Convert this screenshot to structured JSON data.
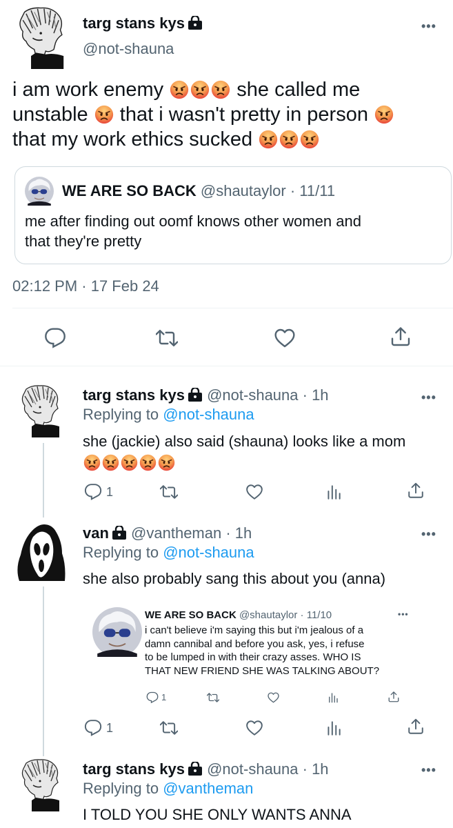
{
  "main_tweet": {
    "display_name": "targ stans kys",
    "handle": "@not-shauna",
    "text_line1_a": "i am work enemy",
    "text_line1_b": "she called me",
    "text_line2_a": "unstable",
    "text_line2_b": "that i wasn't pretty in person",
    "text_line3_a": "that my work ethics sucked",
    "timestamp": "02:12 PM · 17 Feb 24",
    "quote": {
      "display_name": "WE ARE SO BACK",
      "handle_date": "@shautaylor · 11/11",
      "text_line1": "me after finding out oomf knows other women and",
      "text_line2": "that they're pretty"
    }
  },
  "replies": [
    {
      "display_name": "targ stans kys",
      "meta": "@not-shauna · 1h",
      "replying_prefix": "Replying to",
      "replying_handle": "@not-shauna",
      "text": "she (jackie) also said (shauna) looks like a mom",
      "reply_count": "1"
    },
    {
      "display_name": "van",
      "meta": "@vantheman · 1h",
      "replying_prefix": "Replying to",
      "replying_handle": "@not-shauna",
      "text": "she also probably sang this about you (anna)",
      "reply_count": "1",
      "embedded": {
        "display_name": "WE ARE SO BACK",
        "meta": "@shautaylor · 11/10",
        "line1": "i can't believe i'm saying this but i'm jealous of a",
        "line2": "damn cannibal and before you ask, yes, i refuse",
        "line3": "to be lumped in with their crazy asses. WHO IS",
        "line4": "THAT NEW FRIEND SHE WAS TALKING ABOUT?",
        "reply_count": "1"
      }
    },
    {
      "display_name": "targ stans kys",
      "meta": "@not-shauna · 1h",
      "replying_prefix": "Replying to",
      "replying_handle": "@vantheman",
      "text": "I TOLD YOU SHE ONLY WANTS ANNA"
    }
  ],
  "more_label": "•••",
  "colors": {
    "accent": "#1d9bf0",
    "muted": "#536471",
    "text": "#0f1419"
  }
}
